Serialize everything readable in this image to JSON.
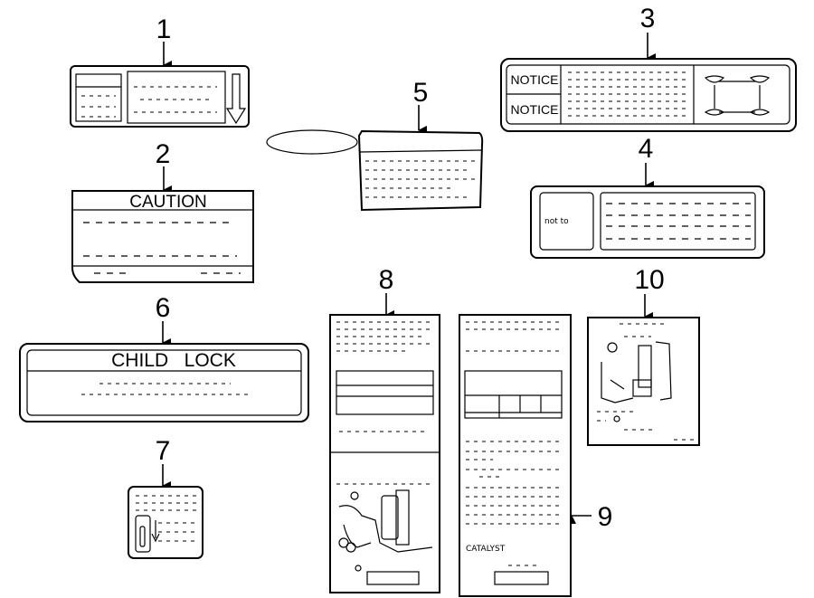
{
  "callouts": [
    "1",
    "2",
    "3",
    "4",
    "5",
    "6",
    "7",
    "8",
    "9",
    "10"
  ],
  "labels": {
    "caution": "CAUTION",
    "notice_top": "NOTICE",
    "notice_bottom": "NOTICE",
    "child_lock": "CHILD   LOCK",
    "catalyst": "CATALYST",
    "handwriting": "not to"
  }
}
